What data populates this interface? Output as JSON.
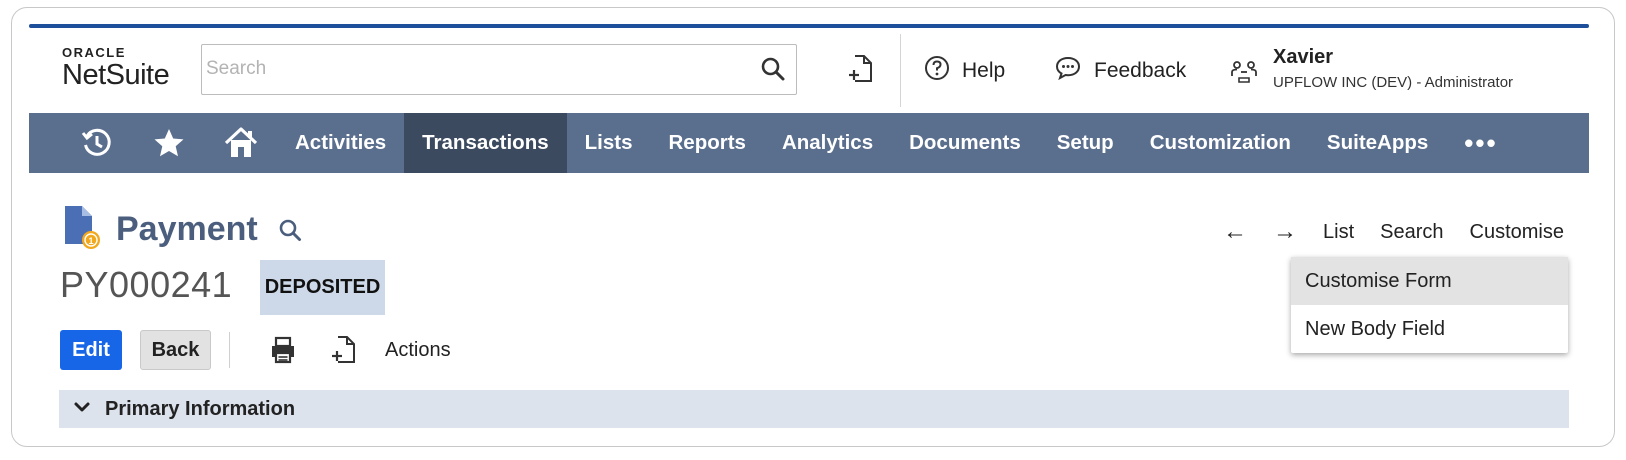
{
  "header": {
    "logo_top": "ORACLE",
    "logo_bottom": "NetSuite",
    "search_placeholder": "Search",
    "help_label": "Help",
    "feedback_label": "Feedback",
    "user_name": "Xavier",
    "user_role": "UPFLOW INC (DEV) - Administrator"
  },
  "nav": {
    "icons": [
      "recent-icon",
      "star-icon",
      "home-icon"
    ],
    "items": [
      "Activities",
      "Transactions",
      "Lists",
      "Reports",
      "Analytics",
      "Documents",
      "Setup",
      "Customization",
      "SuiteApps"
    ],
    "active": "Transactions",
    "more_label": "•••"
  },
  "record": {
    "title": "Payment",
    "tran_id": "PY000241",
    "status": "DEPOSITED",
    "links": {
      "list": "List",
      "search": "Search",
      "customise": "Customise"
    },
    "prev_arrow": "←",
    "next_arrow": "→"
  },
  "toolbar": {
    "edit_label": "Edit",
    "back_label": "Back",
    "actions_label": "Actions"
  },
  "customise_menu": {
    "items": [
      "Customise Form",
      "New Body Field"
    ],
    "highlighted": "Customise Form"
  },
  "section": {
    "label": "Primary Information"
  },
  "colors": {
    "nav_bg": "#5a6e8e",
    "nav_active": "#3c4a60",
    "accent": "#1766e8",
    "title": "#4b5e7d",
    "status_bg": "#cdd9e8",
    "section_bg": "#dde3ec"
  }
}
